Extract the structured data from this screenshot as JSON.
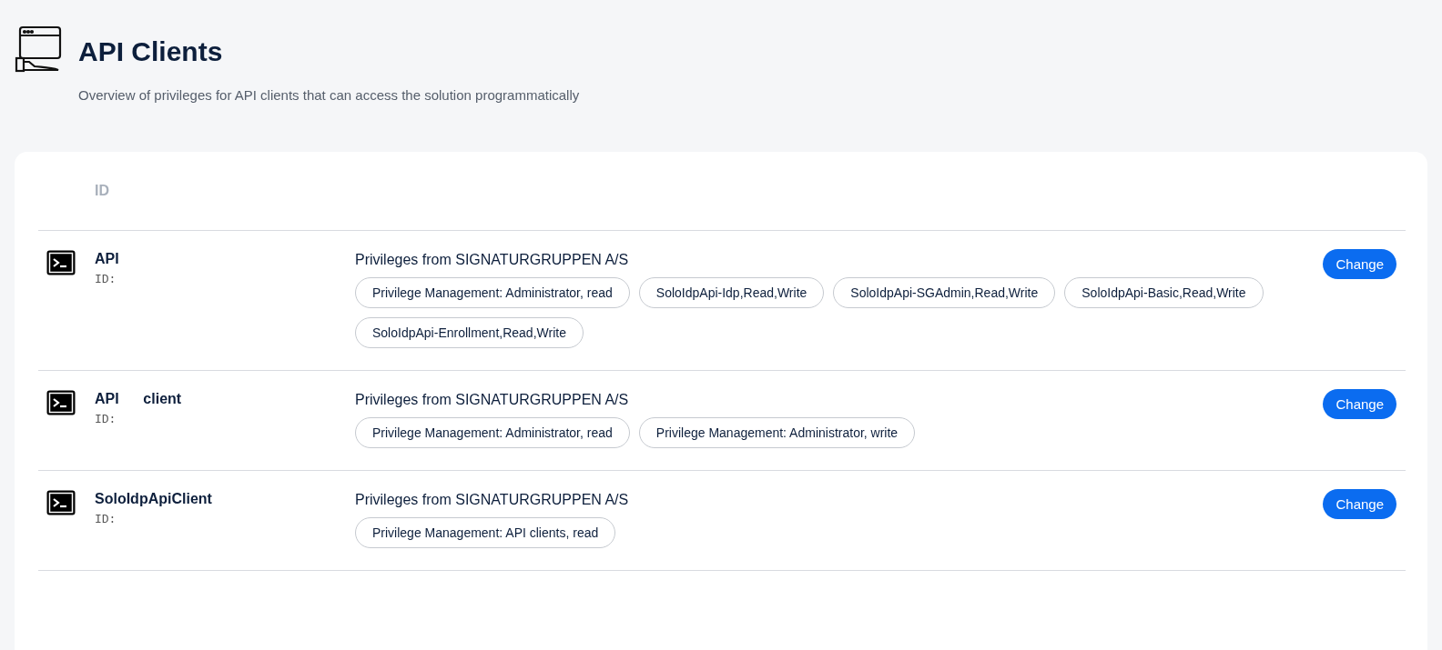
{
  "header": {
    "title": "API Clients",
    "subtitle": "Overview of privileges for API clients that can access the solution programmatically"
  },
  "table": {
    "columns": [
      "ID"
    ],
    "rows": [
      {
        "name": "API",
        "id_label": "ID:",
        "privileges_title": "Privileges from SIGNATURGRUPPEN A/S",
        "privileges": [
          "Privilege Management: Administrator, read",
          "SoloIdpApi-Idp,Read,Write",
          "SoloIdpApi-SGAdmin,Read,Write",
          "SoloIdpApi-Basic,Read,Write",
          "SoloIdpApi-Enrollment,Read,Write"
        ],
        "action": "Change"
      },
      {
        "name": "API      client",
        "id_label": "ID:",
        "privileges_title": "Privileges from SIGNATURGRUPPEN A/S",
        "privileges": [
          "Privilege Management: Administrator, read",
          "Privilege Management: Administrator, write"
        ],
        "action": "Change"
      },
      {
        "name": "SoloIdpApiClient",
        "id_label": "ID:",
        "privileges_title": "Privileges from SIGNATURGRUPPEN A/S",
        "privileges": [
          "Privilege Management: API clients, read"
        ],
        "action": "Change"
      }
    ]
  }
}
